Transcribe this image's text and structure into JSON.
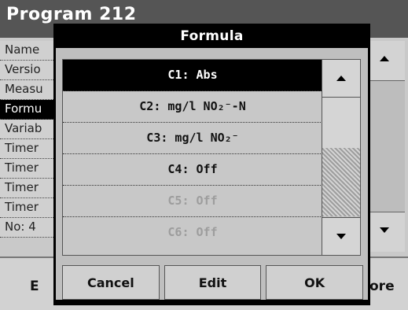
{
  "background": {
    "title": "Program 212",
    "rows": [
      "Name",
      "Versio",
      "Measu",
      "Formu",
      "Variab",
      "Timer",
      "Timer",
      "Timer",
      "Timer",
      "No: 4"
    ],
    "selected_row_index": 3,
    "bottom_left_label": "E",
    "bottom_right_label": "ore"
  },
  "dialog": {
    "title": "Formula",
    "items": [
      {
        "label": "C1: Abs",
        "state": "selected"
      },
      {
        "label": "C2: mg/l NO₂⁻-N",
        "state": "normal"
      },
      {
        "label": "C3: mg/l NO₂⁻",
        "state": "normal"
      },
      {
        "label": "C4: Off",
        "state": "normal"
      },
      {
        "label": "C5: Off",
        "state": "disabled"
      },
      {
        "label": "C6: Off",
        "state": "disabled"
      }
    ],
    "buttons": {
      "cancel": "Cancel",
      "edit": "Edit",
      "ok": "OK"
    }
  },
  "icons": {
    "scroll_up": "arrow-up-icon",
    "scroll_down": "arrow-down-icon"
  }
}
